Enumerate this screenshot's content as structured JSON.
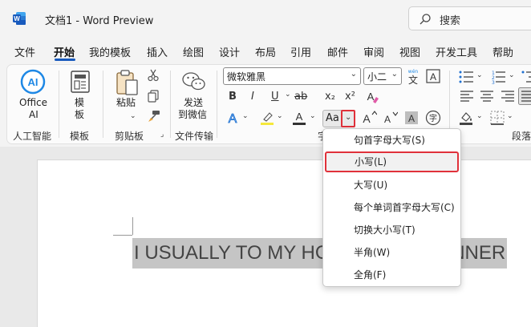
{
  "titlebar": {
    "title": "文档1  -  Word Preview",
    "search_placeholder": "搜索",
    "app_icon": "word-icon",
    "brand_color": "#185abd"
  },
  "menubar": {
    "tabs": [
      {
        "label": "文件"
      },
      {
        "label": "开始",
        "active": true
      },
      {
        "label": "我的模板"
      },
      {
        "label": "插入"
      },
      {
        "label": "绘图"
      },
      {
        "label": "设计"
      },
      {
        "label": "布局"
      },
      {
        "label": "引用"
      },
      {
        "label": "邮件"
      },
      {
        "label": "审阅"
      },
      {
        "label": "视图"
      },
      {
        "label": "开发工具"
      },
      {
        "label": "帮助"
      }
    ]
  },
  "ribbon": {
    "ai": {
      "button_label_1": "Office",
      "button_label_2": "AI",
      "group_label": "人工智能"
    },
    "template": {
      "button_label_1": "模",
      "button_label_2": "板",
      "group_label": "模板"
    },
    "clipboard": {
      "paste_label": "粘贴",
      "group_label": "剪贴板"
    },
    "transfer": {
      "button_label_1": "发送",
      "button_label_2": "到微信",
      "group_label": "文件传输"
    },
    "font": {
      "font_name": "微软雅黑",
      "font_size": "小二",
      "bold": "B",
      "italic": "I",
      "underline": "U",
      "strike": "ab",
      "subscript": "x₂",
      "superscript": "x²",
      "case_button_label": "Aa",
      "group_label_fragment": "字"
    },
    "paragraph": {
      "group_label": "段落"
    }
  },
  "case_menu": {
    "items": [
      {
        "label": "句首字母大写(S)"
      },
      {
        "label": "小写(L)",
        "highlighted": true
      },
      {
        "label": "大写(U)"
      },
      {
        "label": "每个单词首字母大写(C)"
      },
      {
        "label": "切换大小写(T)"
      },
      {
        "label": "半角(W)"
      },
      {
        "label": "全角(F)"
      }
    ],
    "highlight_color": "#e0313a"
  },
  "document": {
    "selected_text": "I USUALLY TO MY HOME AFTER DINNER"
  }
}
